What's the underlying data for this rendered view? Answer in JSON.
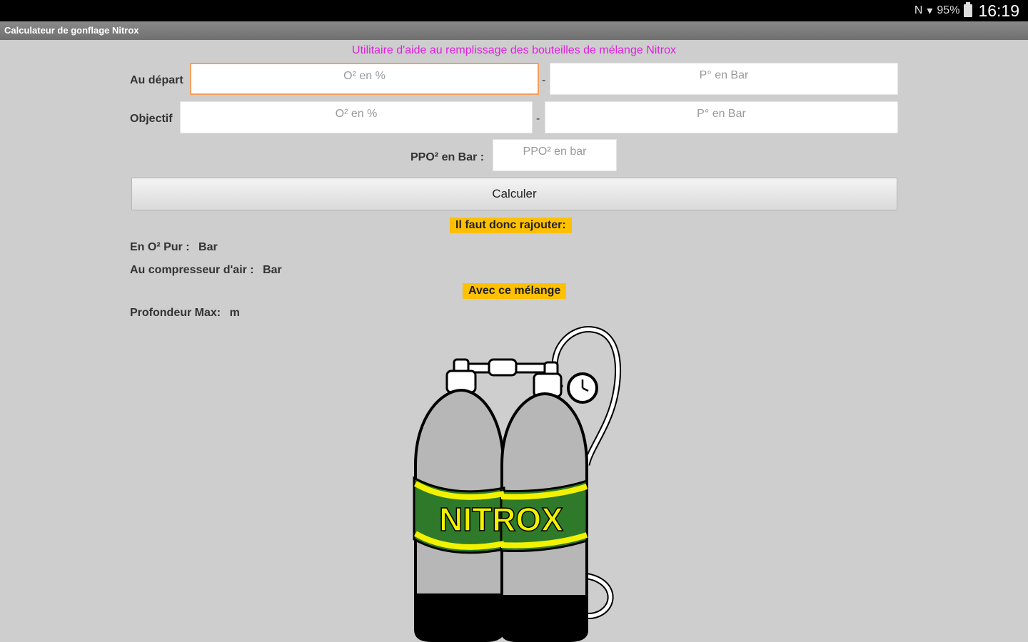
{
  "status_bar": {
    "battery": "95%",
    "time": "16:19"
  },
  "app": {
    "title": "Calculateur de gonflage Nitrox",
    "subtitle": "Utilitaire d'aide au remplissage des bouteilles de mélange Nitrox"
  },
  "form": {
    "start_label": "Au départ",
    "start_o2_placeholder": "O² en %",
    "start_p_placeholder": "P° en Bar",
    "target_label": "Objectif",
    "target_o2_placeholder": "O² en %",
    "target_p_placeholder": "P° en Bar",
    "separator": "-",
    "ppo2_label": "PPO² en Bar :",
    "ppo2_placeholder": "PPO² en bar",
    "calculate_label": "Calculer"
  },
  "results": {
    "add_heading": "Il faut donc rajouter:",
    "pure_o2_label": "En O² Pur  :",
    "pure_o2_unit": "Bar",
    "air_label": "Au compresseur d'air :",
    "air_unit": "Bar",
    "mix_heading": "Avec ce mélange",
    "depth_label": "Profondeur Max:",
    "depth_unit": "m"
  },
  "illustration": {
    "tank_text": "NITROX",
    "colors": {
      "tank": "#b7b7b7",
      "band": "#2f7a2a",
      "stripe": "#f2f200",
      "text": "#f2f200"
    }
  },
  "colors": {
    "subtitle": "#e020e0",
    "badge": "#ffc000",
    "focus": "#f0a060"
  }
}
